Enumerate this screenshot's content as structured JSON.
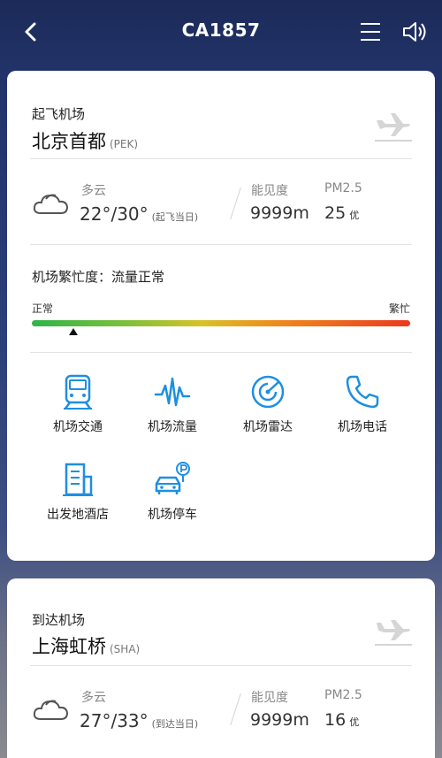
{
  "header": {
    "title": "CA1857"
  },
  "departure": {
    "label": "起飞机场",
    "city": "北京首都",
    "code": "(PEK)",
    "weather": {
      "condition": "多云",
      "temp": "22°/30°",
      "temp_note": "(起飞当日)",
      "visibility_label": "能见度",
      "visibility": "9999m",
      "pm_label": "PM2.5",
      "pm_value": "25",
      "pm_grade": "优"
    },
    "busy": {
      "label": "机场繁忙度：流量正常",
      "low_label": "正常",
      "high_label": "繁忙",
      "level": 0.11
    },
    "tools": [
      {
        "label": "机场交通",
        "icon": "train-icon"
      },
      {
        "label": "机场流量",
        "icon": "traffic-wave-icon"
      },
      {
        "label": "机场雷达",
        "icon": "radar-icon"
      },
      {
        "label": "机场电话",
        "icon": "phone-icon"
      },
      {
        "label": "出发地酒店",
        "icon": "hotel-building-icon"
      },
      {
        "label": "机场停车",
        "icon": "parking-car-icon"
      }
    ]
  },
  "arrival": {
    "label": "到达机场",
    "city": "上海虹桥",
    "code": "(SHA)",
    "weather": {
      "condition": "多云",
      "temp": "27°/33°",
      "temp_note": "(到达当日)",
      "visibility_label": "能见度",
      "visibility": "9999m",
      "pm_label": "PM2.5",
      "pm_value": "16",
      "pm_grade": "优"
    }
  },
  "colors": {
    "accent": "#1e8fe0",
    "background": "#22336a"
  }
}
